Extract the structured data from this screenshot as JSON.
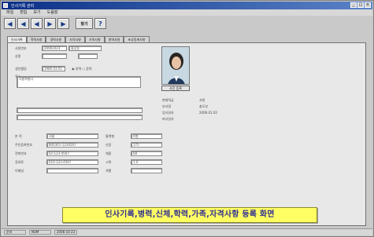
{
  "window": {
    "title": "인사기록 관리",
    "controls": [
      "_",
      "□",
      "×"
    ]
  },
  "menu": [
    "파일",
    "편집",
    "보기",
    "도움말"
  ],
  "toolbar": {
    "buttons": [
      "◀",
      "◀",
      "◀",
      "▶",
      "▶"
    ],
    "search": "찾기",
    "misc": "?"
  },
  "tabs": [
    "인사기록",
    "학력사항",
    "경력사항",
    "자격사항",
    "가족사항",
    "병역사항",
    "포상징계사항"
  ],
  "photo": {
    "button": "사진 등록"
  },
  "form": {
    "row1_label": "사원번호",
    "row1_value": "20061023",
    "row1_name": "홍길동",
    "row2_label": "성명",
    "row2_value": "",
    "row2_extra": "",
    "row3_label": "생년월일",
    "row3_value": "1980.03.01",
    "row3_radio": "◉ 양력  ○ 음력",
    "addr_label": "주소",
    "addr_value": "서울특별시",
    "right_labels": [
      "현재직급",
      "부서명",
      "입사일자",
      "퇴사일자"
    ],
    "right_values": [
      "사원",
      "총무부",
      "2006.01.02",
      ""
    ],
    "lower_rows": [
      {
        "label": "본 적",
        "value": "서울",
        "mid_label": "혈액형",
        "mid_value": "A형"
      },
      {
        "label": "주민등록번호",
        "value": "800301-1234567",
        "mid_label": "신장",
        "mid_value": "175"
      },
      {
        "label": "전화번호",
        "value": "02-123-4567",
        "mid_label": "체중",
        "mid_value": "68"
      },
      {
        "label": "휴대폰",
        "value": "010-123-4567",
        "mid_label": "시력",
        "mid_value": "1.0"
      },
      {
        "label": "이메일",
        "value": "",
        "mid_label": "색맹",
        "mid_value": ""
      }
    ]
  },
  "caption": "인사기록,병력,신체,학력,가족,자격사항 등록 화면",
  "status": [
    "준비",
    "NUM",
    "2006-10-23"
  ]
}
